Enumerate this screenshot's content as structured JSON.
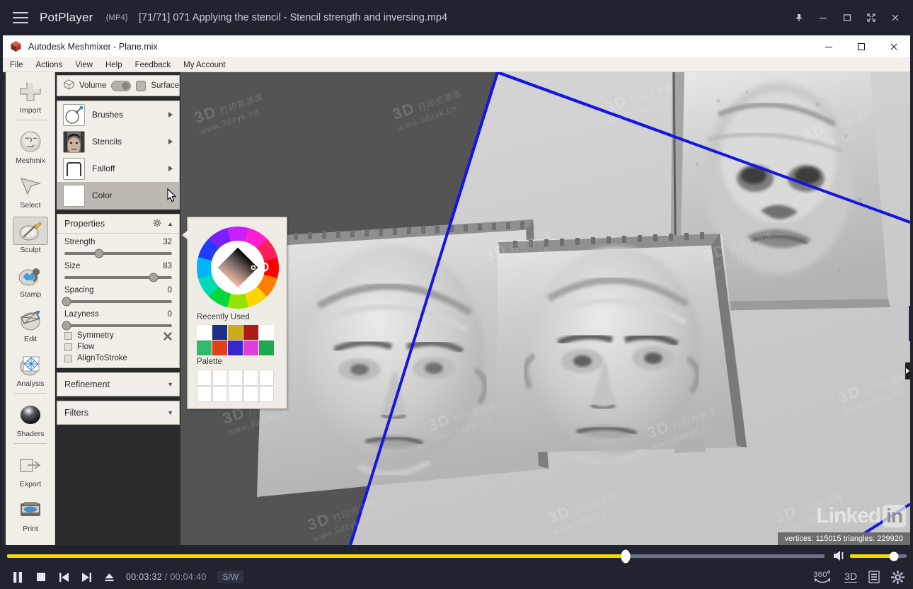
{
  "player": {
    "app_name": "PotPlayer",
    "format_badge": "{MP4}",
    "file_title": "[71/71] 071 Applying the stencil - Stencil strength and inversing.mp4",
    "icons": {
      "hamburger": "hamburger-menu-icon",
      "pin": "pin-icon",
      "minimize": "minimize-icon",
      "maximize": "maximize-icon",
      "fullscreen": "fullscreen-icon",
      "close": "close-icon"
    },
    "seek": {
      "progress_percent": 75.7
    },
    "volume": {
      "level_percent": 78
    },
    "controls": {
      "pause": "Pause",
      "stop": "Stop",
      "previous": "Previous",
      "next": "Next",
      "eject": "Open file",
      "current_time": "00:03:32",
      "separator": "/",
      "total_time": "00:04:40",
      "sw_badge": "S/W",
      "btn_360": "360°",
      "btn_3d": "3D",
      "playlist": "playlist-icon",
      "settings": "gear-icon"
    }
  },
  "meshmixer": {
    "title": "Autodesk Meshmixer - Plane.mix",
    "window_controls": {
      "minimize": "—",
      "maximize": "☐",
      "close": "✕"
    },
    "menu": [
      "File",
      "Actions",
      "View",
      "Help",
      "Feedback",
      "My Account"
    ],
    "toolbar": [
      {
        "label": "Import",
        "icon": "plus-icon",
        "selected": false,
        "sep_after": true
      },
      {
        "label": "Meshmix",
        "icon": "meshmix-face-icon",
        "selected": false,
        "sep_after": false
      },
      {
        "label": "Select",
        "icon": "cursor-arrow-icon",
        "selected": false,
        "sep_after": false
      },
      {
        "label": "Sculpt",
        "icon": "sculpt-brush-icon",
        "selected": true,
        "sep_after": false
      },
      {
        "label": "Stamp",
        "icon": "stamp-icon",
        "selected": false,
        "sep_after": false
      },
      {
        "label": "Edit",
        "icon": "edit-sphere-icon",
        "selected": false,
        "sep_after": false
      },
      {
        "label": "Analysis",
        "icon": "analysis-mesh-icon",
        "selected": false,
        "sep_after": true
      },
      {
        "label": "Shaders",
        "icon": "shaders-sphere-icon",
        "selected": false,
        "sep_after": true
      },
      {
        "label": "Export",
        "icon": "export-icon",
        "selected": false,
        "sep_after": false
      },
      {
        "label": "Print",
        "icon": "printer-icon",
        "selected": false,
        "sep_after": false
      }
    ],
    "sculpt_panel": {
      "mode": {
        "volume_label": "Volume",
        "surface_label": "Surface",
        "volume_icon": "cube-icon",
        "active": "Volume"
      },
      "browser_rows": [
        {
          "label": "Brushes",
          "icon": "brush-thumb-icon",
          "active": false
        },
        {
          "label": "Stencils",
          "icon": "stencil-face-thumb-icon",
          "active": false
        },
        {
          "label": "Falloff",
          "icon": "falloff-curve-thumb-icon",
          "active": false
        },
        {
          "label": "Color",
          "icon": "color-swatch-thumb-icon",
          "active": true
        }
      ],
      "properties": {
        "title": "Properties",
        "gear_icon": "gear-icon",
        "collapse_caret": "▲",
        "sliders": [
          {
            "label": "Strength",
            "value": "32",
            "percent": 32
          },
          {
            "label": "Size",
            "value": "83",
            "percent": 83
          },
          {
            "label": "Spacing",
            "value": "0",
            "percent": 0
          },
          {
            "label": "Lazyness",
            "value": "0",
            "percent": 0
          }
        ],
        "checkboxes": [
          {
            "label": "Symmetry",
            "checked": false
          },
          {
            "label": "Flow",
            "checked": false
          },
          {
            "label": "AlignToStroke",
            "checked": false
          }
        ],
        "tools_icon": "wrench-cross-icon"
      },
      "sections": [
        {
          "title": "Refinement",
          "caret": "▼"
        },
        {
          "title": "Filters",
          "caret": "▼"
        }
      ]
    },
    "color_popup": {
      "wheel_icon": "color-wheel-icon",
      "recently_used_label": "Recently Used",
      "palette_label": "Palette",
      "recently_used": [
        "#ffffff",
        "#1c2f86",
        "#ccac16",
        "#ab1c16",
        "#ffffff",
        "#2fba6c",
        "#e2401b",
        "#3628cc",
        "#e040d8",
        "#1aa951"
      ],
      "palette": [
        "#ffffff",
        "#ffffff",
        "#ffffff",
        "#ffffff",
        "#ffffff",
        "#ffffff",
        "#ffffff",
        "#ffffff",
        "#ffffff",
        "#ffffff"
      ]
    },
    "viewport": {
      "status_text": "vertices: 115015 triangles: 229920",
      "background_color": "#545454",
      "plane_color": "#cfcfcf",
      "outline_color": "#1516e0",
      "linkedin_watermark_main": "Linked",
      "linkedin_watermark_badge": "in",
      "site_watermark": "www.3dzyk.cn",
      "site_watermark_logo": "3D"
    },
    "cursor": "mouse-pointer"
  }
}
